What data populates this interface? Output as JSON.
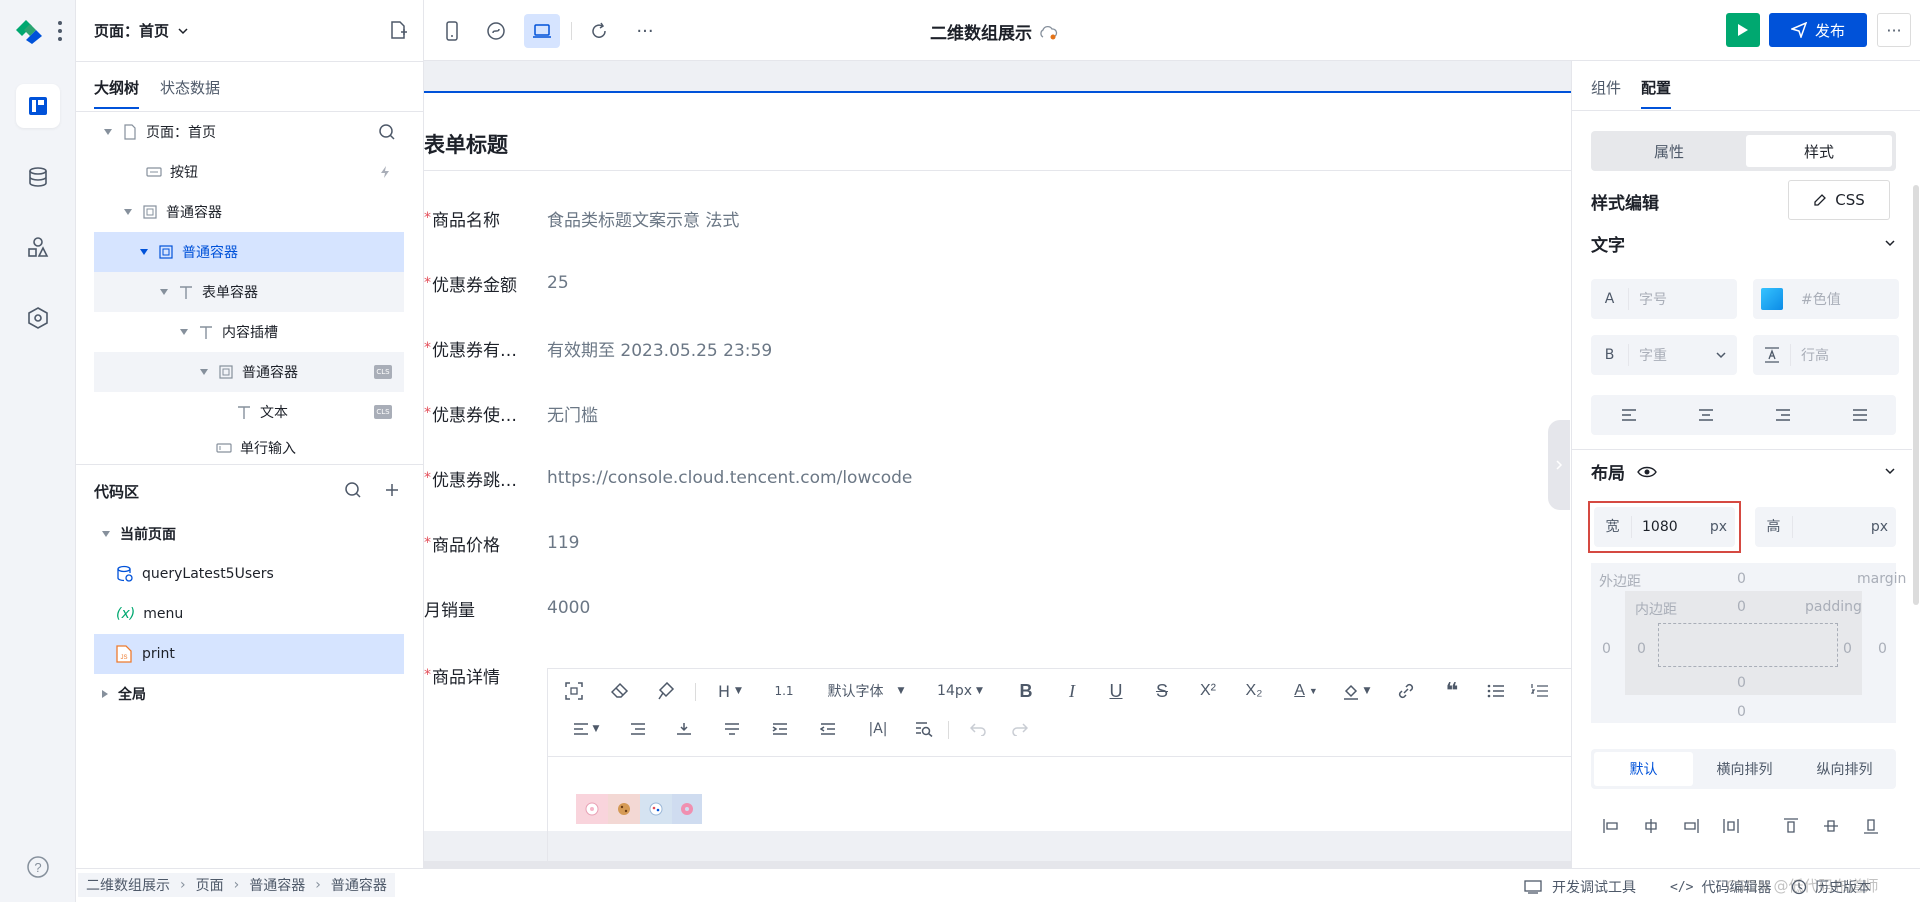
{
  "page_selector": "页面：首页",
  "left_tabs": [
    "大纲树",
    "状态数据"
  ],
  "tree": [
    {
      "label": "页面：首页"
    },
    {
      "label": "按钮"
    },
    {
      "label": "普通容器"
    },
    {
      "label": "普通容器"
    },
    {
      "label": "表单容器"
    },
    {
      "label": "内容插槽"
    },
    {
      "label": "普通容器",
      "badge": "CLS"
    },
    {
      "label": "文本",
      "badge": "CLS"
    },
    {
      "label": "单行输入"
    }
  ],
  "code_area": {
    "title": "代码区",
    "current_page": "当前页面",
    "items": [
      "queryLatest5Users",
      "menu",
      "print"
    ],
    "global": "全局",
    "var_glyph": "(x)"
  },
  "app_title": "二维数组展示",
  "toolbar": {
    "publish": "发布",
    "more": "···"
  },
  "form": {
    "title": "表单标题",
    "rows": [
      {
        "label": "商品名称",
        "value": "食品类标题文案示意 法式",
        "required": true
      },
      {
        "label": "优惠券金额",
        "value": "25",
        "required": true
      },
      {
        "label": "优惠券有…",
        "value": "有效期至 2023.05.25 23:59",
        "required": true
      },
      {
        "label": "优惠券使…",
        "value": "无门槛",
        "required": true
      },
      {
        "label": "优惠券跳…",
        "value": "https://console.cloud.tencent.com/lowcode",
        "required": true
      },
      {
        "label": "商品价格",
        "value": "119",
        "required": true
      },
      {
        "label": "月销量",
        "value": "4000",
        "required": false
      },
      {
        "label": "商品详情",
        "value": "",
        "required": true
      }
    ],
    "editor": {
      "heading": "H",
      "line_height_glyph": "1.1",
      "font_family": "默认字体",
      "font_size": "14px"
    }
  },
  "right_panel": {
    "tabs": [
      "组件",
      "配置"
    ],
    "seg": [
      "属性",
      "样式"
    ],
    "style_edit": "样式编辑",
    "css_btn": "CSS",
    "text_section": "文字",
    "font_size_prefix": "A",
    "font_size_ph": "字号",
    "color_ph": "#色值",
    "weight_prefix": "B",
    "weight_ph": "字重",
    "line_height_ph": "行高",
    "layout_section": "布局",
    "width_label": "宽",
    "width_value": "1080",
    "width_unit": "px",
    "height_label": "高",
    "height_unit": "px",
    "margin_label": "外边距",
    "margin_en": "margin",
    "padding_label": "内边距",
    "padding_en": "padding",
    "zero": "0",
    "direction": [
      "默认",
      "横向排列",
      "纵向排列"
    ]
  },
  "footer": {
    "breadcrumb": [
      "二维数组展示",
      "页面",
      "普通容器",
      "普通容器"
    ],
    "dev_tools": "开发调试工具",
    "code_editor": "代码编辑器",
    "history": "历史版本",
    "watermark": "CSDN @低代码布道师"
  },
  "colors": {
    "brand": "#0052d9",
    "green": "#00a870",
    "selected_bg": "#d6e4ff",
    "highlight_box": "#d54941"
  }
}
